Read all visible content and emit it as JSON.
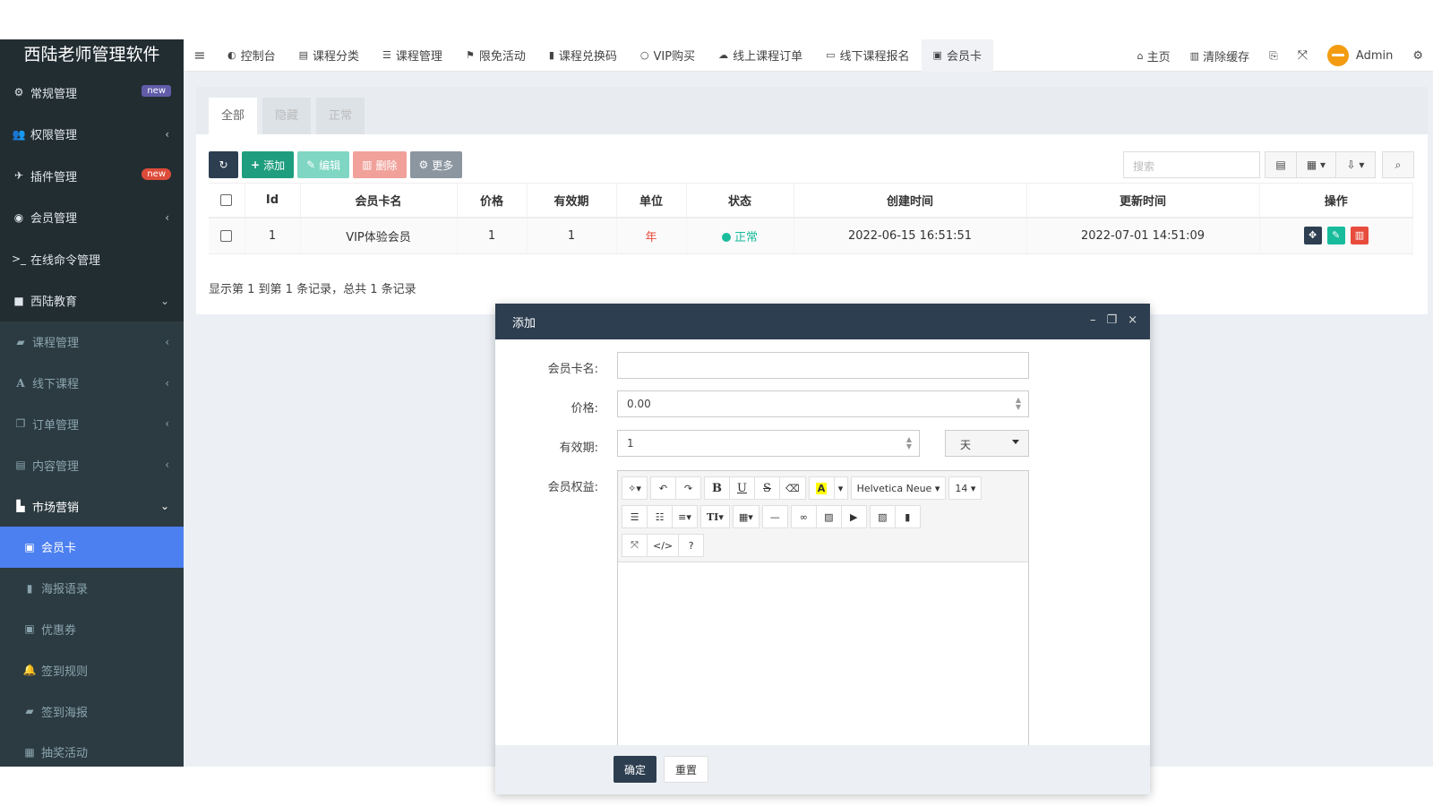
{
  "sidebar": {
    "logo": "西陆老师管理软件",
    "items": [
      {
        "label": "常规管理",
        "icon": "cogs-icon",
        "badge": "new",
        "badge_color": "#605ca8"
      },
      {
        "label": "权限管理",
        "icon": "users-icon",
        "arrow": "‹"
      },
      {
        "label": "插件管理",
        "icon": "rocket-icon",
        "badge": "new",
        "badge_color": "#dd4b39"
      },
      {
        "label": "会员管理",
        "icon": "user-circle-icon",
        "arrow": "‹"
      },
      {
        "label": "在线命令管理",
        "icon": "terminal-icon"
      },
      {
        "label": "西陆教育",
        "icon": "folder-icon",
        "arrow": "⌄"
      }
    ],
    "sub_items": [
      {
        "label": "课程管理",
        "icon": "book-icon",
        "arrow": "‹"
      },
      {
        "label": "线下课程",
        "icon": "font-icon",
        "arrow": "‹"
      },
      {
        "label": "订单管理",
        "icon": "copy-icon",
        "arrow": "‹"
      },
      {
        "label": "内容管理",
        "icon": "list-alt-icon",
        "arrow": "‹"
      },
      {
        "label": "市场营销",
        "icon": "chart-icon",
        "arrow": "⌄"
      },
      {
        "label": "会员卡",
        "icon": "id-card-icon"
      },
      {
        "label": "海报语录",
        "icon": "file-icon"
      },
      {
        "label": "优惠券",
        "icon": "ticket-icon"
      },
      {
        "label": "签到规则",
        "icon": "bell-icon"
      },
      {
        "label": "签到海报",
        "icon": "book-icon"
      },
      {
        "label": "抽奖活动",
        "icon": "file-alt-icon"
      }
    ]
  },
  "topnav": {
    "tabs": [
      {
        "label": "控制台",
        "icon": "dashboard-icon",
        "glyph": "◐"
      },
      {
        "label": "课程分类",
        "icon": "list-icon",
        "glyph": "▤"
      },
      {
        "label": "课程管理",
        "icon": "list-ul-icon",
        "glyph": "☰"
      },
      {
        "label": "限免活动",
        "icon": "flag-icon",
        "glyph": "⚑"
      },
      {
        "label": "课程兑换码",
        "icon": "bookmark-icon",
        "glyph": "▮"
      },
      {
        "label": "VIP购买",
        "icon": "circle-icon",
        "glyph": "○"
      },
      {
        "label": "线上课程订单",
        "icon": "cloud-icon",
        "glyph": "☁"
      },
      {
        "label": "线下课程报名",
        "icon": "folder-open-icon",
        "glyph": "▭"
      },
      {
        "label": "会员卡",
        "icon": "id-card-icon",
        "glyph": "▣"
      }
    ],
    "right": {
      "home": "主页",
      "clear_cache": "清除缓存",
      "user": "Admin"
    }
  },
  "panel": {
    "tabs": [
      "全部",
      "隐藏",
      "正常"
    ],
    "toolbar": {
      "add": "添加",
      "edit": "编辑",
      "delete": "删除",
      "more": "更多"
    },
    "search_placeholder": "搜索",
    "columns": [
      "Id",
      "会员卡名",
      "价格",
      "有效期",
      "单位",
      "状态",
      "创建时间",
      "更新时间",
      "操作"
    ],
    "rows": [
      {
        "id": "1",
        "name": "VIP体验会员",
        "price": "1",
        "validity": "1",
        "unit": "年",
        "status": "正常",
        "created": "2022-06-15 16:51:51",
        "updated": "2022-07-01 14:51:09"
      }
    ],
    "summary": "显示第 1 到第 1 条记录，总共 1 条记录"
  },
  "modal": {
    "title": "添加",
    "fields": {
      "name_label": "会员卡名:",
      "name_value": "",
      "price_label": "价格:",
      "price_value": "0.00",
      "validity_label": "有效期:",
      "validity_value": "1",
      "unit_value": "天",
      "benefits_label": "会员权益:"
    },
    "editor": {
      "font": "Helvetica Neue",
      "size": "14"
    },
    "buttons": {
      "ok": "确定",
      "reset": "重置"
    }
  },
  "colors": {
    "sidebar_bg": "#222d32",
    "active_item": "#4c7ff0",
    "header_dark": "#2c3e50",
    "success": "#18bc9c",
    "danger": "#e74c3c"
  }
}
